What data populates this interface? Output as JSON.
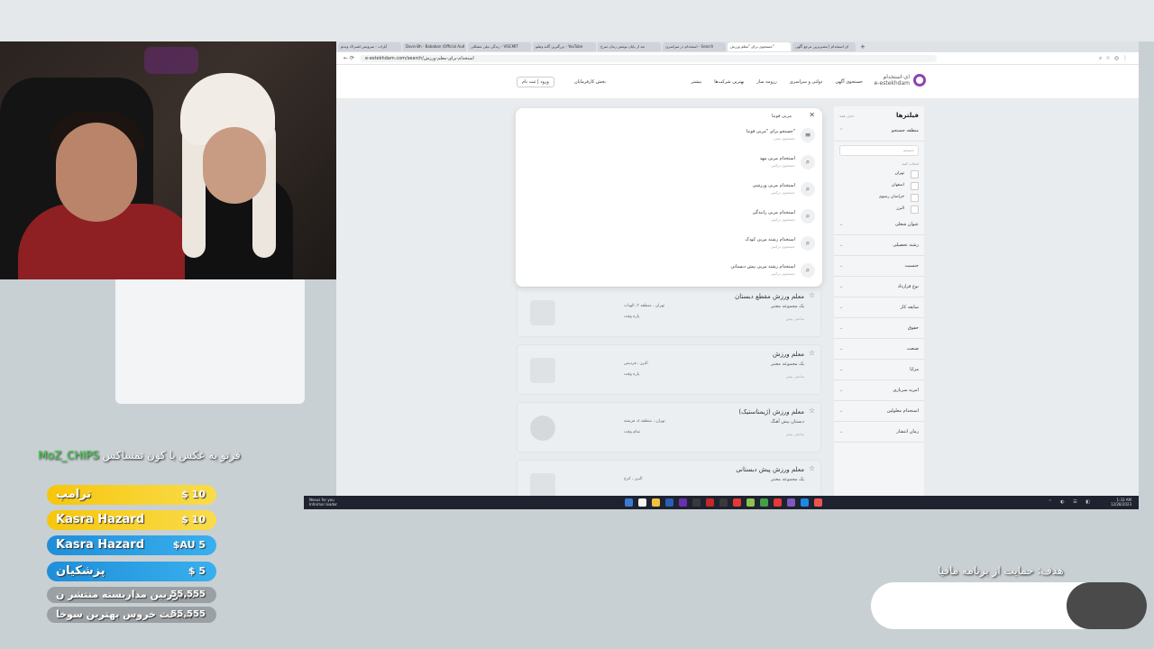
{
  "browser": {
    "tabs": [
      "آپارات - سرویس اشتراک ویدئو",
      "ای استخدام | معتبرترین مرجع آگهی",
      "جستجوی برای \"معلم ورزش\"",
      "استخدام در سراسری - Search",
      "بعد از پایان نوشتن زمان سرخ",
      "بزرگترین گانه وطنو - YouTube",
      "زندگی تیلی مشکلی - VISCMIT",
      "Davis-Bh - Bababan (Official Aud",
      "ای استخدام"
    ],
    "url": "e-estekhdam.com/search/استخدام-برای-معلم-ورزش"
  },
  "site": {
    "logo_fa": "ای-استخدام",
    "logo_en": "e-estekhdam",
    "menu": [
      "جستجوی آگهی",
      "دولتی و سراسری",
      "رزومه ساز",
      "بهترین شرکت‌ها",
      "بیشتر"
    ],
    "employer": "بخش کارفرمایان",
    "login": "ورود | ثبت نام"
  },
  "filters": {
    "title": "فیلترها",
    "clear": "حذف همه",
    "search_region": "منطقه جستجو",
    "search_placeholder": "جستجو",
    "hint": "انتخاب کنید",
    "cities": [
      "تهران",
      "اصفهان",
      "خراسان رضوی",
      "البرز"
    ],
    "sections": [
      "عنوان شغلی",
      "رشته تحصیلی",
      "جنسیت",
      "نوع قرارداد",
      "سابقه کار",
      "حقوق",
      "صنعت",
      "مزایا",
      "امریه سربازی",
      "استخدام معلولین",
      "زمان انتشار"
    ]
  },
  "popup": {
    "query": "مربی فوتبا",
    "close": "✕",
    "suggestions": [
      {
        "main": "جستجو برای \"مربی فوتبا\"",
        "sub": "جستجوی متنی",
        "icon": "≡"
      },
      {
        "main": "استخدام مربی مهد",
        "sub": "جستجوی ترکیبی",
        "icon": "⌕"
      },
      {
        "main": "استخدام مربی ورزشی",
        "sub": "جستجوی ترکیبی",
        "icon": "⌕"
      },
      {
        "main": "استخدام مربی رانندگی",
        "sub": "جستجوی ترکیبی",
        "icon": "⌕"
      },
      {
        "main": "استخدام رشته مربی کودک",
        "sub": "جستجوی ترکیبی",
        "icon": "⌕"
      },
      {
        "main": "استخدام رشته مربی پیش دبستانی",
        "sub": "جستجوی ترکیبی",
        "icon": "⌕"
      }
    ]
  },
  "jobs": [
    {
      "title": "معلم ورزش مقطع دبستان",
      "company": "یک مجموعه معتبر",
      "loc": "تهران ، منطقه ۳، الهیات",
      "time": "پاره وقت",
      "ago": "ساعتی پیش"
    },
    {
      "title": "معلم ورزش",
      "company": "یک مجموعه معتبر",
      "loc": "البرز ، فردیس",
      "time": "پاره وقت",
      "ago": "ساعتی پیش"
    },
    {
      "title": "معلم ورزش (ژیمناستیک)",
      "company": "دبستان پیش آهنگ",
      "loc": "تهران ، منطقه ۸، فرشته",
      "time": "تمام وقت",
      "ago": "ساعتی پیش"
    },
    {
      "title": "معلم ورزش پیش دبستانی",
      "company": "یک مجموعه معتبر",
      "loc": "البرز ، کرج",
      "time": "",
      "ago": ""
    }
  ],
  "taskbar": {
    "weather_line1": "Nexus for you",
    "weather_line2": "Informor leader",
    "time": "1:33 AM",
    "date": "12/28/2023",
    "icon_colors": [
      "#3a7bd5",
      "#f5f5f5",
      "#f0c43c",
      "#2b5fb4",
      "#6b2fb4",
      "#3a3a3a",
      "#c62828",
      "#3a3a3a",
      "#e53935",
      "#8bc34a",
      "#43a047",
      "#e53935",
      "#7e57c2",
      "#1e88e5",
      "#ef5350"
    ]
  },
  "donations": {
    "title_prefix": "فرتو به عکس با کون تمساکس",
    "title_name": "MoZ_CHIPS",
    "items": [
      {
        "name": "ترامپ",
        "amount": "$ 10",
        "style": "gold"
      },
      {
        "name": "Kasra Hazard",
        "amount": "$ 10",
        "style": "gold"
      },
      {
        "name": "Kasra Hazard",
        "amount": "$AU 5",
        "style": "blue"
      },
      {
        "name": "پزشکیان",
        "amount": "$ 5",
        "style": "blue"
      },
      {
        "name": "دوربین مداربسته منتشر ن...",
        "amount": "55,555",
        "style": "gray"
      },
      {
        "name": "بحث خروس بهترین سوخا...",
        "amount": "55,555",
        "style": "gray"
      }
    ]
  },
  "goal": {
    "label": "هدف: حمایت از برنامه مافیا",
    "progress": 0.29
  }
}
